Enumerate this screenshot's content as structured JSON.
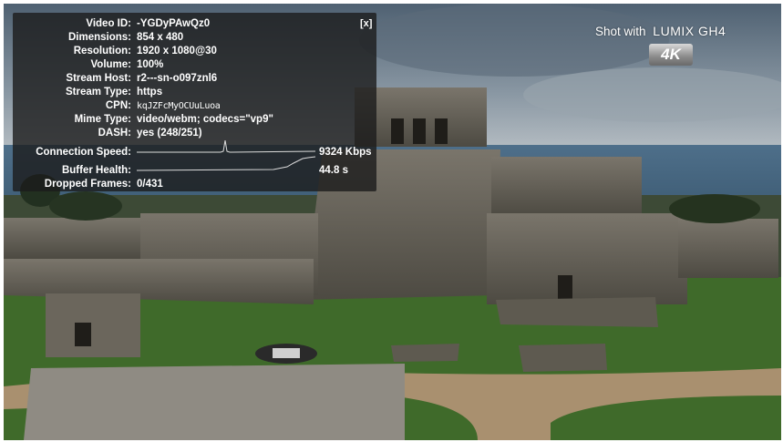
{
  "stats_panel": {
    "close_label": "[x]",
    "rows": [
      {
        "label": "Video ID:",
        "value": "-YGDyPAwQz0"
      },
      {
        "label": "Dimensions:",
        "value": "854 x 480"
      },
      {
        "label": "Resolution:",
        "value": "1920 x 1080@30"
      },
      {
        "label": "Volume:",
        "value": "100%"
      },
      {
        "label": "Stream Host:",
        "value": "r2---sn-o097znl6"
      },
      {
        "label": "Stream Type:",
        "value": "https"
      },
      {
        "label": "CPN:",
        "value": "kqJZFcMyOCUuLuoa"
      },
      {
        "label": "Mime Type:",
        "value": "video/webm; codecs=\"vp9\""
      },
      {
        "label": "DASH:",
        "value": "yes (248/251)"
      }
    ],
    "connection_speed": {
      "label": "Connection Speed:",
      "value": "9324 Kbps"
    },
    "buffer_health": {
      "label": "Buffer Health:",
      "value": "44.8 s"
    },
    "dropped_frames": {
      "label": "Dropped Frames:",
      "value": "0/431"
    }
  },
  "overlay": {
    "shot_with": "Shot with",
    "camera": "LUMIX GH4",
    "badge": "4K"
  },
  "colors": {
    "panel_bg": "#1c1c1c",
    "text": "#ffffff",
    "grass": "#3f6a2a",
    "path": "#a9906f",
    "stone": "#6b665c"
  }
}
